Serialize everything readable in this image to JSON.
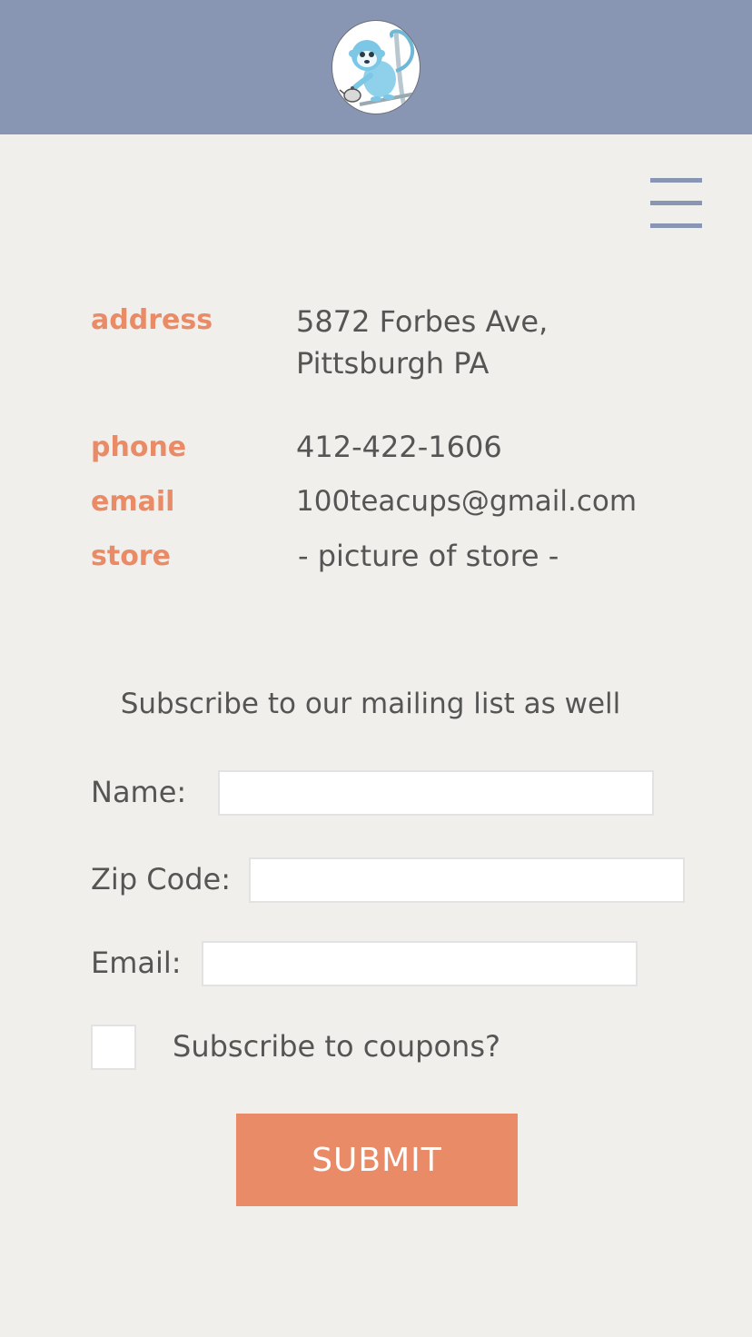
{
  "header": {
    "logo_icon": "monkey-teapot-logo",
    "background_color": "#8896b3"
  },
  "menu": {
    "icon": "hamburger-menu-icon"
  },
  "contact": {
    "address": {
      "label": "address",
      "line1": "5872 Forbes Ave,",
      "line2": "Pittsburgh PA"
    },
    "phone": {
      "label": "phone",
      "value": "412-422-1606"
    },
    "email": {
      "label": "email",
      "value": "100teacups@gmail.com"
    },
    "store": {
      "label": "store",
      "value": "- picture of store -"
    }
  },
  "subscribe": {
    "title": "Subscribe to our mailing list as well",
    "name_label": "Name:",
    "name_value": "",
    "zip_label": "Zip Code:",
    "zip_value": "",
    "email_label": "Email:",
    "email_value": "",
    "coupons_label": "Subscribe to coupons?",
    "coupons_checked": false,
    "submit_label": "SUBMIT"
  },
  "colors": {
    "accent": "#e98b66",
    "page_background": "#f1efeb",
    "text": "#555555"
  }
}
